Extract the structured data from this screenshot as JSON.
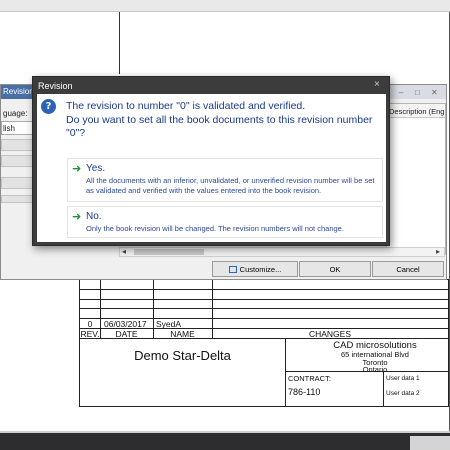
{
  "back_dialog": {
    "title": "Revisions",
    "language_label": "guage:",
    "language_value": "lish",
    "description_header": "Description (Engl",
    "window_controls": [
      "–",
      "□",
      "✕"
    ],
    "buttons": {
      "customize": "Customize...",
      "ok": "OK",
      "cancel": "Cancel"
    }
  },
  "revision_dialog": {
    "title": "Revision",
    "close": "×",
    "message": "The revision to number \"0\" is validated and verified.\nDo you want to set all the book documents to this revision number \"0\"?",
    "options": [
      {
        "title": "Yes.",
        "description": "All the documents with an inferior, unvalidated, or unverified revision number will be set as validated and verified with the values entered into the book revision."
      },
      {
        "title": "No.",
        "description": "Only the book revision will be changed. The revision numbers will not change."
      }
    ]
  },
  "title_block": {
    "revision_row": {
      "rev": "0",
      "date": "06/03/2017",
      "name": "SyedA"
    },
    "headers": {
      "rev": "REV.",
      "date": "DATE",
      "name": "NAME",
      "changes": "CHANGES"
    },
    "drawing_title": "Demo Star-Delta",
    "company": {
      "name": "CAD microsolutions",
      "address1": "65 international Blvd",
      "city": "Toronto",
      "province": "Ontario"
    },
    "contract_label": "CONTRACT:",
    "contract_value": "786-110",
    "user_data_1": "User data 1",
    "user_data_2": "User data 2"
  },
  "colors": {
    "dialog_frame": "#3c3c3c",
    "message_text": "#1b3a8c",
    "arrow_green": "#1a9b32",
    "info_icon": "#2a63b8"
  }
}
